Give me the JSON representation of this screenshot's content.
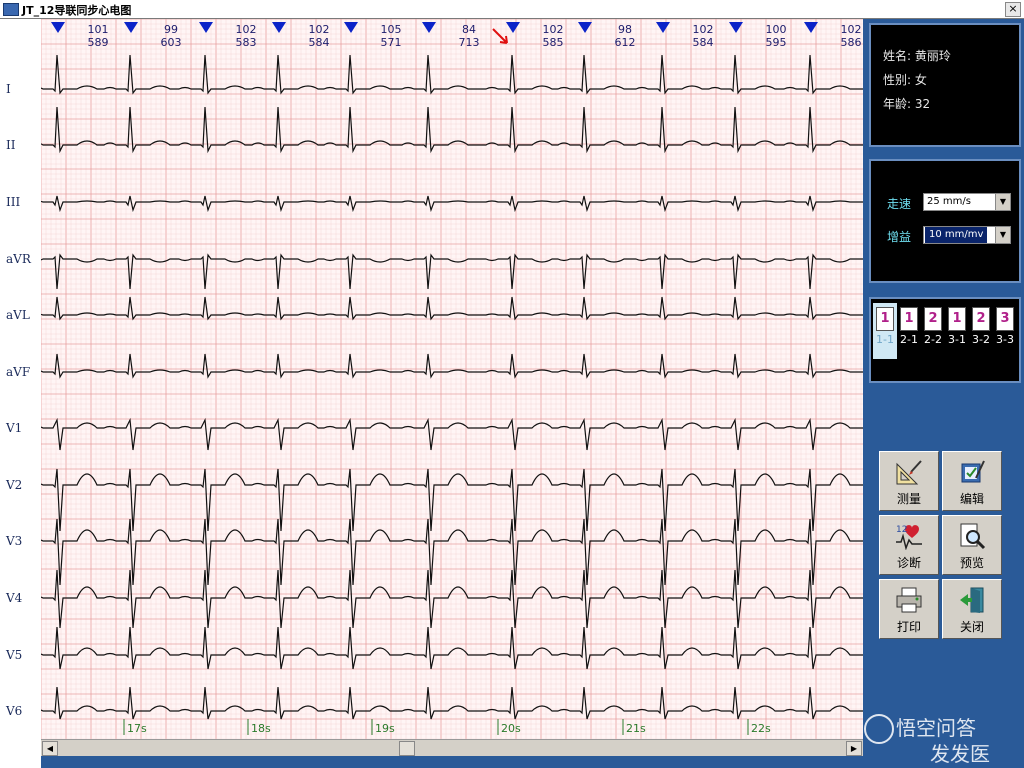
{
  "window": {
    "title": "JT_12导联同步心电图",
    "close": "×"
  },
  "leads": [
    "I",
    "II",
    "III",
    "aVR",
    "aVL",
    "aVF",
    "V1",
    "V2",
    "V3",
    "V4",
    "V5",
    "V6"
  ],
  "rr_markers": [
    {
      "hr": "101",
      "rr": "589"
    },
    {
      "hr": "99",
      "rr": "603"
    },
    {
      "hr": "102",
      "rr": "583"
    },
    {
      "hr": "102",
      "rr": "584"
    },
    {
      "hr": "105",
      "rr": "571"
    },
    {
      "hr": "84",
      "rr": "713"
    },
    {
      "hr": "102",
      "rr": "585"
    },
    {
      "hr": "98",
      "rr": "612"
    },
    {
      "hr": "102",
      "rr": "584"
    },
    {
      "hr": "100",
      "rr": "595"
    },
    {
      "hr": "102",
      "rr": "586"
    }
  ],
  "time_marks": [
    "17s",
    "18s",
    "19s",
    "20s",
    "21s",
    "22s"
  ],
  "patient": {
    "name_label": "姓名:",
    "name": "黄丽玲",
    "sex_label": "性别:",
    "sex": "女",
    "age_label": "年龄:",
    "age": "32"
  },
  "controls": {
    "speed_label": "走速",
    "speed_value": "25 mm/s",
    "gain_label": "增益",
    "gain_value": "10 mm/mv"
  },
  "layouts": [
    {
      "icon": "1",
      "label": "1-1"
    },
    {
      "icon": "1",
      "label": "2-1"
    },
    {
      "icon": "2",
      "label": "2-2"
    },
    {
      "icon": "1",
      "label": "3-1"
    },
    {
      "icon": "2",
      "label": "3-2"
    },
    {
      "icon": "3",
      "label": "3-3"
    }
  ],
  "buttons": {
    "measure": "测量",
    "edit": "编辑",
    "diagnose": "诊断",
    "preview": "预览",
    "print": "打印",
    "close": "关闭"
  },
  "watermark": {
    "line1": "悟空问答",
    "line2": "发发医"
  },
  "colors": {
    "panel_bg": "#2a5a98",
    "grid_major": "#e8a0a0",
    "grid_minor": "#f4d0d0",
    "trace": "#111111",
    "marker": "#0b23c8"
  }
}
